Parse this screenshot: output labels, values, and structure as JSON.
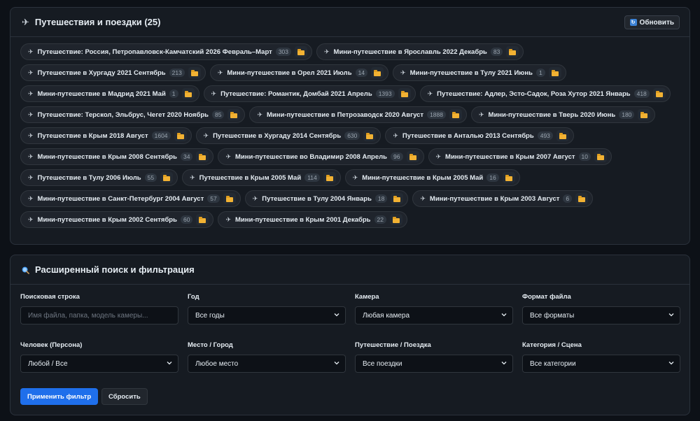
{
  "trips_panel": {
    "title": "Путешествия и поездки (25)",
    "plane_icon": "airplane-icon",
    "refresh_label": "Обновить",
    "trips": [
      {
        "label": "Путешествие: Россия, Петропавловск-Камчатский 2026 Февраль–Март",
        "count": "303"
      },
      {
        "label": "Мини-путешествие в Ярославль 2022 Декабрь",
        "count": "83"
      },
      {
        "label": "Путешествие в Хургаду 2021 Сентябрь",
        "count": "213"
      },
      {
        "label": "Мини-путешествие в Орел 2021 Июль",
        "count": "14"
      },
      {
        "label": "Мини-путешествие в Тулу 2021 Июнь",
        "count": "1"
      },
      {
        "label": "Мини-путешествие в Мадрид 2021 Май",
        "count": "1"
      },
      {
        "label": "Путешествие: Романтик, Домбай 2021 Апрель",
        "count": "1393"
      },
      {
        "label": "Путешествие: Адлер, Эсто-Садок, Роза Хутор 2021 Январь",
        "count": "418"
      },
      {
        "label": "Путешествие: Терскол, Эльбрус, Чегет 2020 Ноябрь",
        "count": "85"
      },
      {
        "label": "Мини-путешествие в Петрозаводск 2020 Август",
        "count": "1888"
      },
      {
        "label": "Мини-путешествие в Тверь 2020 Июнь",
        "count": "180"
      },
      {
        "label": "Путешествие в Крым 2018 Август",
        "count": "1604"
      },
      {
        "label": "Путешествие в Хургаду 2014 Сентябрь",
        "count": "630"
      },
      {
        "label": "Путешествие в Анталью 2013 Сентябрь",
        "count": "493"
      },
      {
        "label": "Мини-путешествие в Крым 2008 Сентябрь",
        "count": "34"
      },
      {
        "label": "Мини-путешествие во Владимир 2008 Апрель",
        "count": "96"
      },
      {
        "label": "Мини-путешествие в Крым 2007 Август",
        "count": "10"
      },
      {
        "label": "Путешествие в Тулу 2006 Июль",
        "count": "55"
      },
      {
        "label": "Путешествие в Крым 2005 Май",
        "count": "114"
      },
      {
        "label": "Мини-путешествие в Крым 2005 Май",
        "count": "16"
      },
      {
        "label": "Мини-путешествие в Санкт-Петербург 2004 Август",
        "count": "57"
      },
      {
        "label": "Путешествие в Тулу 2004 Январь",
        "count": "18"
      },
      {
        "label": "Мини-путешествие в Крым 2003 Август",
        "count": "6"
      },
      {
        "label": "Мини-путешествие в Крым 2002 Сентябрь",
        "count": "60"
      },
      {
        "label": "Мини-путешествие в Крым 2001 Декабрь",
        "count": "22"
      }
    ]
  },
  "search_panel": {
    "title": "Расширенный поиск и фильтрация",
    "fields": {
      "query": {
        "label": "Поисковая строка",
        "placeholder": "Имя файла, папка, модель камеры..."
      },
      "year": {
        "label": "Год",
        "value": "Все годы"
      },
      "camera": {
        "label": "Камера",
        "value": "Любая камера"
      },
      "format": {
        "label": "Формат файла",
        "value": "Все форматы"
      },
      "person": {
        "label": "Человек (Персона)",
        "value": "Любой / Все"
      },
      "place": {
        "label": "Место / Город",
        "value": "Любое место"
      },
      "trip": {
        "label": "Путешествие / Поездка",
        "value": "Все поездки"
      },
      "category": {
        "label": "Категория / Сцена",
        "value": "Все категории"
      }
    },
    "apply_label": "Применить фильтр",
    "reset_label": "Сбросить"
  },
  "colors": {
    "accent": "#1f6feb",
    "folder": "#f2b233",
    "background": "#0d1117",
    "panel": "#161b22"
  }
}
